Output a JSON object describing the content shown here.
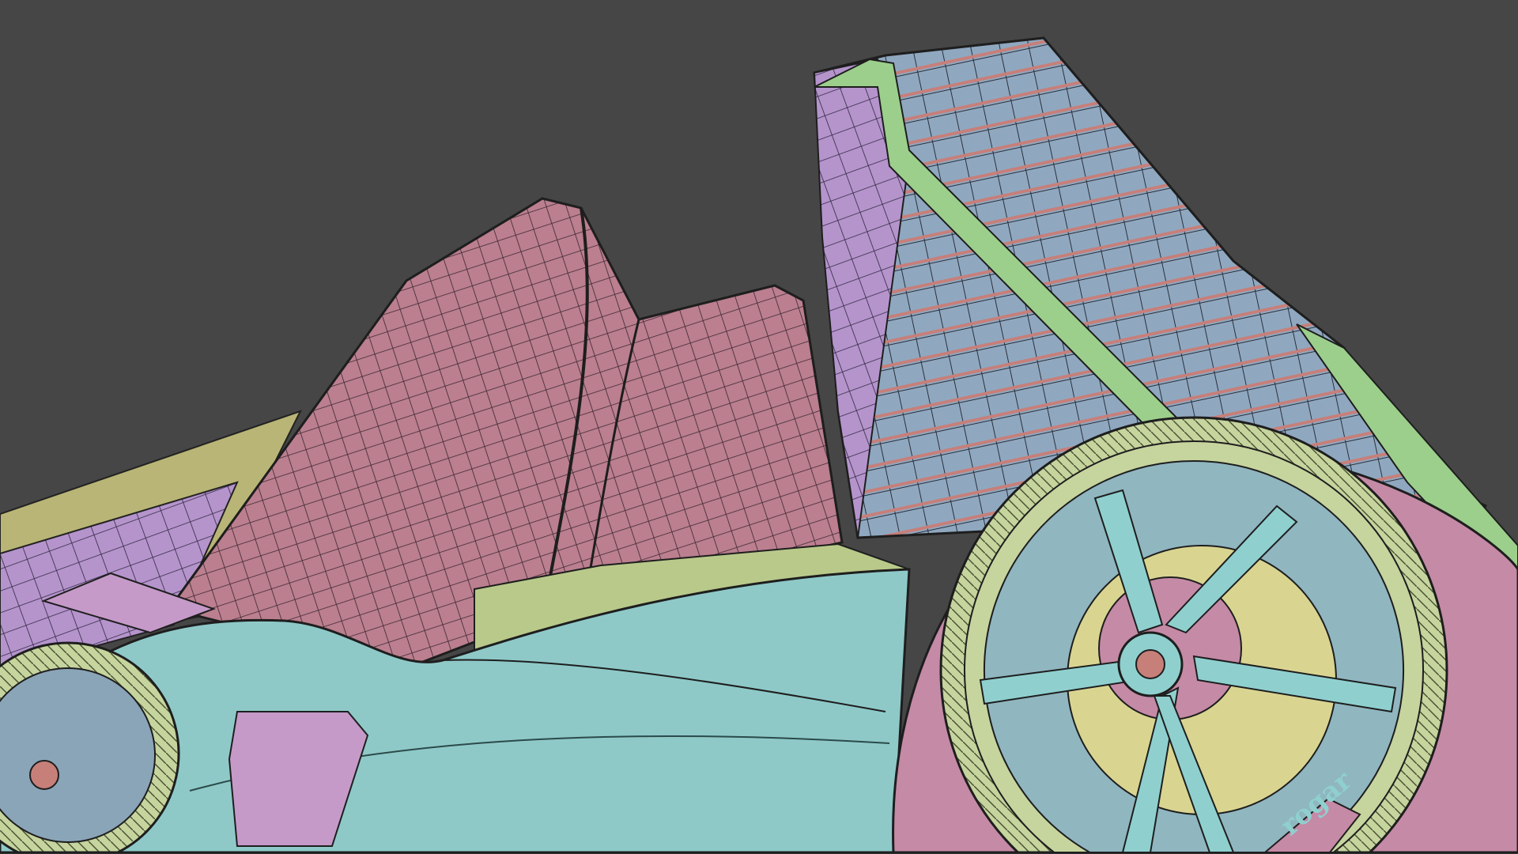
{
  "scene": {
    "caliper_lettering": "rogar"
  },
  "colors": {
    "background": "#464646",
    "tower_glass": "#8fa8c0",
    "tower_purple": "#a98bc9",
    "tower_green": "#9ccf8c",
    "tower_rings": "#c77f7a",
    "pink_building": "#bb7f8f",
    "yellow_building": "#b9b576",
    "car_body": "#8ec9c8",
    "tire": "#c6d49e",
    "fender": "#c58aa6",
    "brake_disc": "#d9d591"
  }
}
